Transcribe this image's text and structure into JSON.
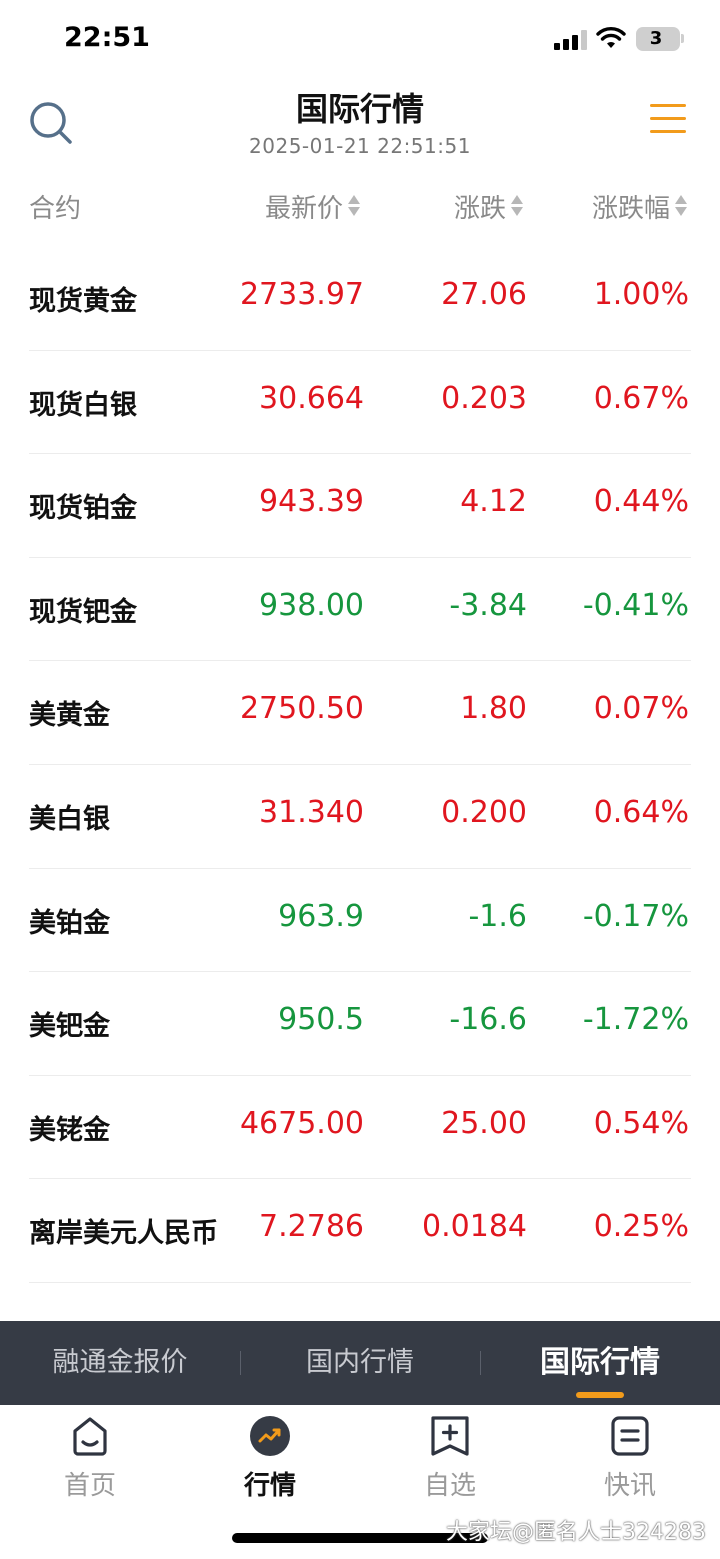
{
  "status": {
    "time": "22:51",
    "battery": "3"
  },
  "header": {
    "title": "国际行情",
    "timestamp": "2025-01-21 22:51:51"
  },
  "columns": {
    "contract": "合约",
    "price": "最新价",
    "change": "涨跌",
    "change_pct": "涨跌幅"
  },
  "rows": [
    {
      "name": "现货黄金",
      "price": "2733.97",
      "change": "27.06",
      "pct": "1.00%",
      "trend": "up"
    },
    {
      "name": "现货白银",
      "price": "30.664",
      "change": "0.203",
      "pct": "0.67%",
      "trend": "up"
    },
    {
      "name": "现货铂金",
      "price": "943.39",
      "change": "4.12",
      "pct": "0.44%",
      "trend": "up"
    },
    {
      "name": "现货钯金",
      "price": "938.00",
      "change": "-3.84",
      "pct": "-0.41%",
      "trend": "down"
    },
    {
      "name": "美黄金",
      "price": "2750.50",
      "change": "1.80",
      "pct": "0.07%",
      "trend": "up"
    },
    {
      "name": "美白银",
      "price": "31.340",
      "change": "0.200",
      "pct": "0.64%",
      "trend": "up"
    },
    {
      "name": "美铂金",
      "price": "963.9",
      "change": "-1.6",
      "pct": "-0.17%",
      "trend": "down"
    },
    {
      "name": "美钯金",
      "price": "950.5",
      "change": "-16.6",
      "pct": "-1.72%",
      "trend": "down"
    },
    {
      "name": "美铑金",
      "price": "4675.00",
      "change": "25.00",
      "pct": "0.54%",
      "trend": "up"
    },
    {
      "name": "离岸美元人民币",
      "price": "7.2786",
      "change": "0.0184",
      "pct": "0.25%",
      "trend": "up"
    }
  ],
  "subtabs": [
    {
      "label": "融通金报价"
    },
    {
      "label": "国内行情"
    },
    {
      "label": "国际行情",
      "active": true
    }
  ],
  "nav": [
    {
      "label": "首页",
      "icon": "home-icon"
    },
    {
      "label": "行情",
      "icon": "market-trend-icon",
      "active": true
    },
    {
      "label": "自选",
      "icon": "add-favorite-icon"
    },
    {
      "label": "快讯",
      "icon": "news-icon"
    }
  ],
  "colors": {
    "up": "#e0161f",
    "down": "#16963e",
    "accent": "#f29b1b",
    "subtab_bg": "#363b45"
  },
  "watermark": "大家坛@匿名人士324283"
}
